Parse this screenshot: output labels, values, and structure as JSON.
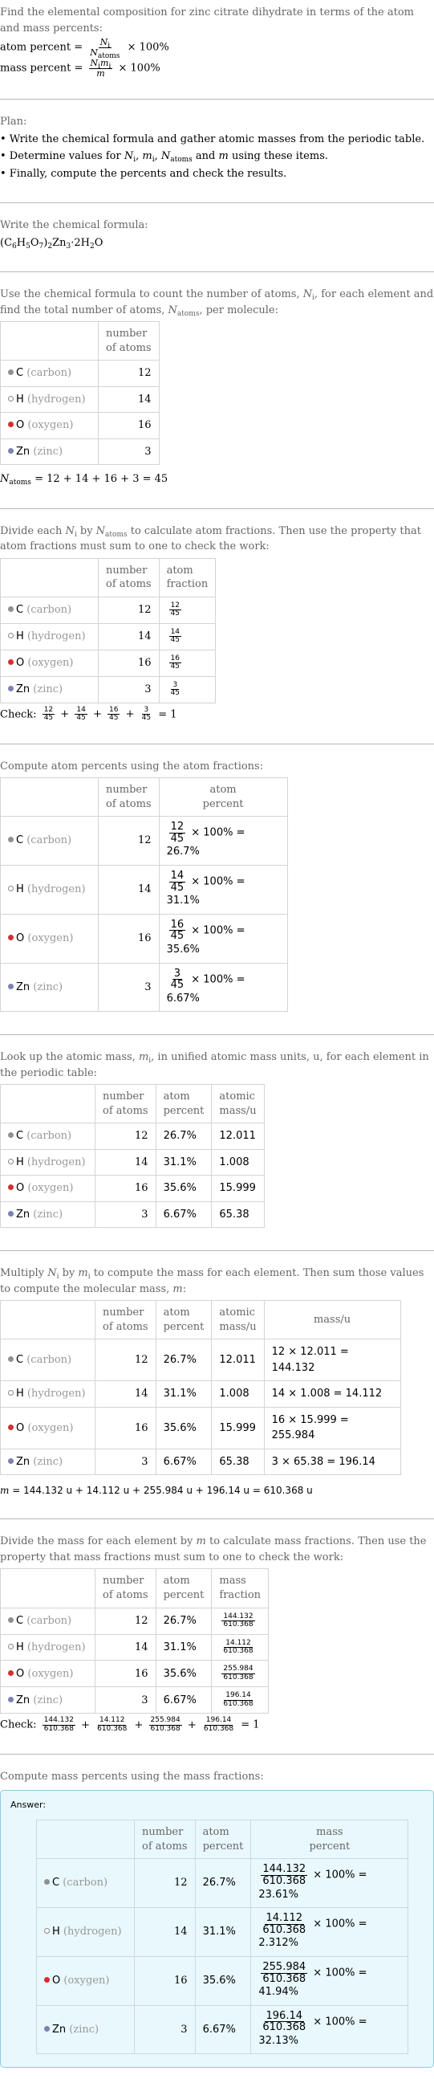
{
  "question": {
    "text": "Find the elemental composition for zinc citrate dihydrate in terms of the atom and mass percents:",
    "atom_percent_label": "atom percent =",
    "atom_percent_num": "N",
    "atom_percent_num_sub": "i",
    "atom_percent_den": "N",
    "atom_percent_den_sub": "atoms",
    "mass_percent_label": "mass percent =",
    "mass_percent_num": "N",
    "mass_percent_num_sub": "i",
    "mass_percent_num2": "m",
    "mass_percent_num2_sub": "i",
    "mass_percent_den": "m",
    "times100": "× 100%"
  },
  "plan": {
    "title": "Plan:",
    "items": [
      "• Write the chemical formula and gather atomic masses from the periodic table.",
      "• Determine values for N_i, m_i, N_atoms and m using these items.",
      "• Finally, compute the percents and check the results."
    ],
    "item2_parts": [
      "• Determine values for ",
      "N",
      "i",
      ", ",
      "m",
      "i",
      ", ",
      "N",
      "atoms",
      " and ",
      "m",
      " using these items."
    ]
  },
  "formula": {
    "intro": "Write the chemical formula:",
    "parts": [
      "(C",
      "6",
      "H",
      "5",
      "O",
      "7",
      ")",
      "2",
      "Zn",
      "3",
      "·2H",
      "2",
      "O"
    ]
  },
  "elements": [
    {
      "symbol": "C",
      "name": "(carbon)",
      "color": "#909090",
      "hollow": false,
      "atoms": "12",
      "fraction_num": "12",
      "fraction_den": "45",
      "atom_percent": "26.7%",
      "atomic_mass": "12.011",
      "mass_expr": "12 × 12.011 = 144.132",
      "mass": "144.132",
      "mass_percent": "23.61%"
    },
    {
      "symbol": "H",
      "name": "(hydrogen)",
      "color": "#ffffff",
      "hollow": true,
      "atoms": "14",
      "fraction_num": "14",
      "fraction_den": "45",
      "atom_percent": "31.1%",
      "atomic_mass": "1.008",
      "mass_expr": "14 × 1.008 = 14.112",
      "mass": "14.112",
      "mass_percent": "2.312%"
    },
    {
      "symbol": "O",
      "name": "(oxygen)",
      "color": "#d42e2e",
      "hollow": false,
      "atoms": "16",
      "fraction_num": "16",
      "fraction_den": "45",
      "atom_percent": "35.6%",
      "atomic_mass": "15.999",
      "mass_expr": "16 × 15.999 = 255.984",
      "mass": "255.984",
      "mass_percent": "41.94%"
    },
    {
      "symbol": "Zn",
      "name": "(zinc)",
      "color": "#7d80b0",
      "hollow": false,
      "atoms": "3",
      "fraction_num": "3",
      "fraction_den": "45",
      "atom_percent": "6.67%",
      "atomic_mass": "65.38",
      "mass_expr": "3 × 65.38 = 196.14",
      "mass": "196.14",
      "mass_percent": "32.13%"
    }
  ],
  "headers": {
    "number_of_atoms": [
      "number",
      "of atoms"
    ],
    "atom_fraction": [
      "atom",
      "fraction"
    ],
    "atom_percent": [
      "atom",
      "percent"
    ],
    "atomic_mass": [
      "atomic",
      "mass/u"
    ],
    "mass": "mass/u",
    "mass_fraction": [
      "mass",
      "fraction"
    ],
    "mass_percent": [
      "mass",
      "percent"
    ]
  },
  "step_count": {
    "intro_parts": [
      "Use the chemical formula to count the number of atoms, ",
      "N",
      "i",
      ", for each element and find the total number of atoms, ",
      "N",
      "atoms",
      ", per molecule:"
    ],
    "total_lhs": "N",
    "total_lhs_sub": "atoms",
    "total_rhs": " = 12 + 14 + 16 + 3 = 45"
  },
  "step_fraction": {
    "intro_parts": [
      "Divide each ",
      "N",
      "i",
      " by ",
      "N",
      "atoms",
      " to calculate atom fractions. Then use the property that atom fractions must sum to one to check the work:"
    ],
    "check_label": "Check:",
    "check_result": "= 1",
    "plus": "+",
    "denominator": "45"
  },
  "step_atom_percent": {
    "intro": "Compute atom percents using the atom fractions:",
    "times100": "× 100% ="
  },
  "step_atomic_mass": {
    "intro_parts": [
      "Look up the atomic mass, ",
      "m",
      "i",
      ", in unified atomic mass units, u, for each element in the periodic table:"
    ]
  },
  "step_mass": {
    "intro_parts": [
      "Multiply ",
      "N",
      "i",
      " by ",
      "m",
      "i",
      " to compute the mass for each element. Then sum those values to compute the molecular mass, ",
      "m",
      ":"
    ],
    "total_lhs": "m",
    "total_rhs": " = 144.132 u + 14.112 u + 255.984 u + 196.14 u = 610.368 u"
  },
  "step_mass_fraction": {
    "intro_parts": [
      "Divide the mass for each element by ",
      "m",
      " to calculate mass fractions. Then use the property that mass fractions must sum to one to check the work:"
    ],
    "denominator": "610.368",
    "check_label": "Check:",
    "check_result": "= 1",
    "plus": "+"
  },
  "step_mass_percent": {
    "intro": "Compute mass percents using the mass fractions:",
    "answer_label": "Answer:",
    "denominator": "610.368",
    "times100": "× 100% ="
  }
}
